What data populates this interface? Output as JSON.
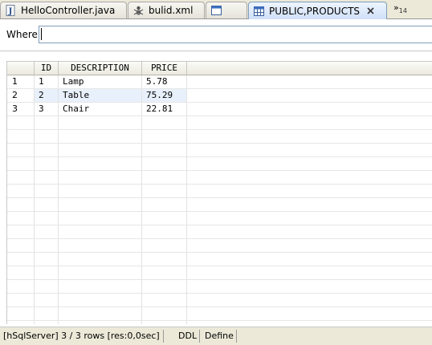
{
  "tabs": [
    {
      "label": "HelloController.java",
      "icon": "java-file-icon"
    },
    {
      "label": "bulid.xml",
      "icon": "ant-build-icon"
    },
    {
      "label": "",
      "icon": "window-icon"
    },
    {
      "label": "PUBLIC,PRODUCTS",
      "icon": "table-icon",
      "active": true
    }
  ],
  "tab_overflow": {
    "chevron": "»",
    "count": "14"
  },
  "where": {
    "label": "Where:",
    "value": ""
  },
  "table": {
    "columns": [
      "",
      "ID",
      "DESCRIPTION",
      "PRICE"
    ],
    "rows": [
      {
        "row_num": "1",
        "id": "1",
        "description": "Lamp",
        "price": "5.78"
      },
      {
        "row_num": "2",
        "id": "2",
        "description": "Table",
        "price": "75.29",
        "selected": true
      },
      {
        "row_num": "3",
        "id": "3",
        "description": "Chair",
        "price": "22.81"
      }
    ]
  },
  "status": {
    "text": "[hSqlServer] 3 / 3 rows [res:0,0sec]",
    "ddl_label": "DDL",
    "define_label": "Define"
  },
  "colors": {
    "selected_row": "#e8f0fb",
    "active_tab": "#cfe0f7",
    "chrome": "#ece9d8"
  }
}
